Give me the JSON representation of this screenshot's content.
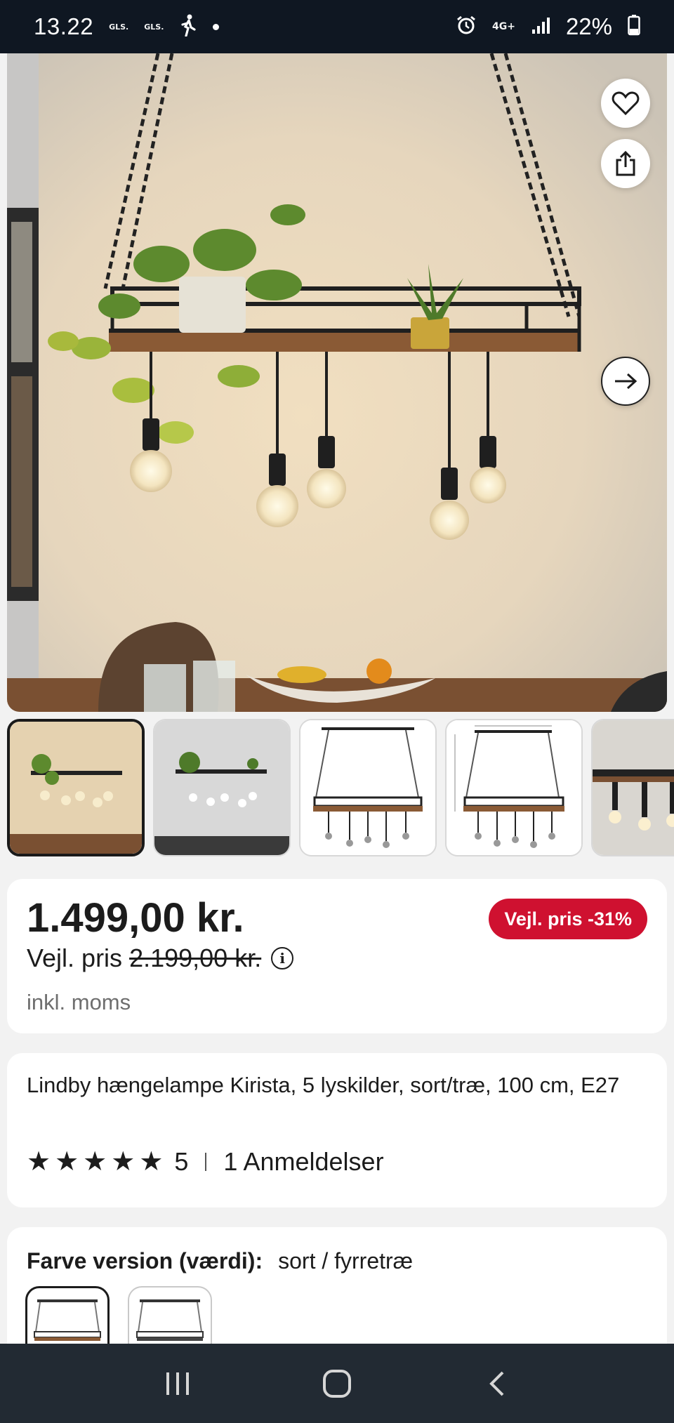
{
  "status_bar": {
    "time": "13.22",
    "icon_labels": [
      "GLS.",
      "GLS."
    ],
    "network": "4G+",
    "battery": "22%"
  },
  "product": {
    "price": "1.499,00 kr.",
    "discount_badge": "Vejl. pris -31%",
    "rrp_label": "Vejl. pris",
    "rrp_value": "2.199,00 kr.",
    "vat_note": "inkl. moms",
    "title": "Lindby hængelampe Kirista, 5 lyskilder, sort/træ, 100 cm, E27",
    "rating": "5",
    "reviews": "1 Anmeldelser",
    "variant_label": "Farve version (værdi):",
    "variant_value": "sort / fyrretræ"
  },
  "colors": {
    "badge": "#cf1130",
    "status_bar": "#0f1722",
    "nav_bar": "#222a33"
  }
}
